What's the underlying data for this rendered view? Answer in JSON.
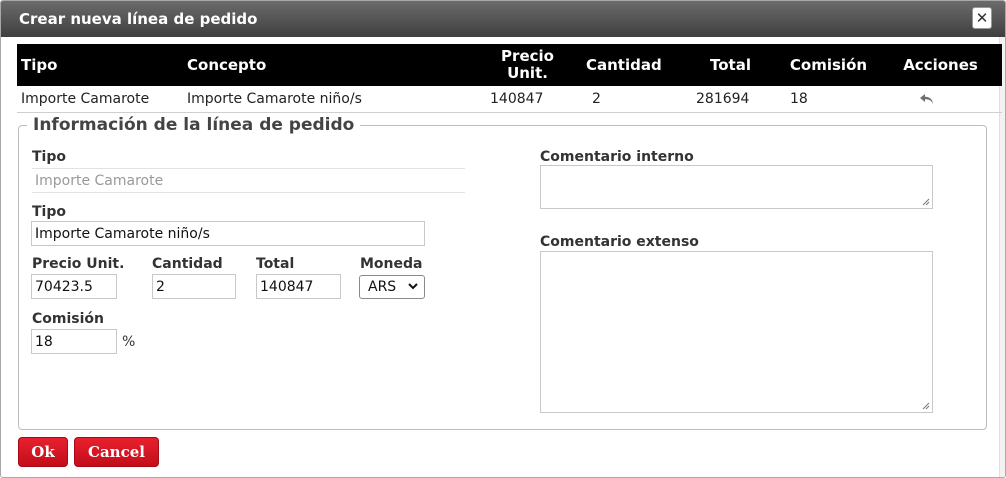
{
  "dialog": {
    "title": "Crear nueva línea de pedido",
    "close_glyph": "✕"
  },
  "table": {
    "headers": {
      "tipo": "Tipo",
      "concepto": "Concepto",
      "precio_unit_1": "Precio",
      "precio_unit_2": "Unit.",
      "cantidad": "Cantidad",
      "total": "Total",
      "comision": "Comisión",
      "acciones": "Acciones"
    },
    "rows": [
      {
        "tipo": "Importe Camarote",
        "concepto": "Importe Camarote niño/s",
        "precio_unit": "140847",
        "cantidad": "2",
        "total": "281694",
        "comision": "18",
        "action_icon": "undo-icon"
      }
    ]
  },
  "form": {
    "legend": "Información de la línea de pedido",
    "tipo_label": "Tipo",
    "tipo_value": "Importe Camarote",
    "tipo2_label": "Tipo",
    "tipo2_value": "Importe Camarote niño/s",
    "precio_label": "Precio Unit.",
    "precio_value": "70423.5",
    "cantidad_label": "Cantidad",
    "cantidad_value": "2",
    "total_label": "Total",
    "total_value": "140847",
    "moneda_label": "Moneda",
    "moneda_value": "ARS",
    "comision_label": "Comisión",
    "comision_value": "18",
    "comision_unit": "%",
    "comentario_interno_label": "Comentario interno",
    "comentario_extenso_label": "Comentario extenso"
  },
  "buttons": {
    "ok": "Ok",
    "cancel": "Cancel"
  },
  "colors": {
    "titlebar": "#4a4a4a",
    "table_header": "#000000",
    "button": "#d7141f"
  }
}
